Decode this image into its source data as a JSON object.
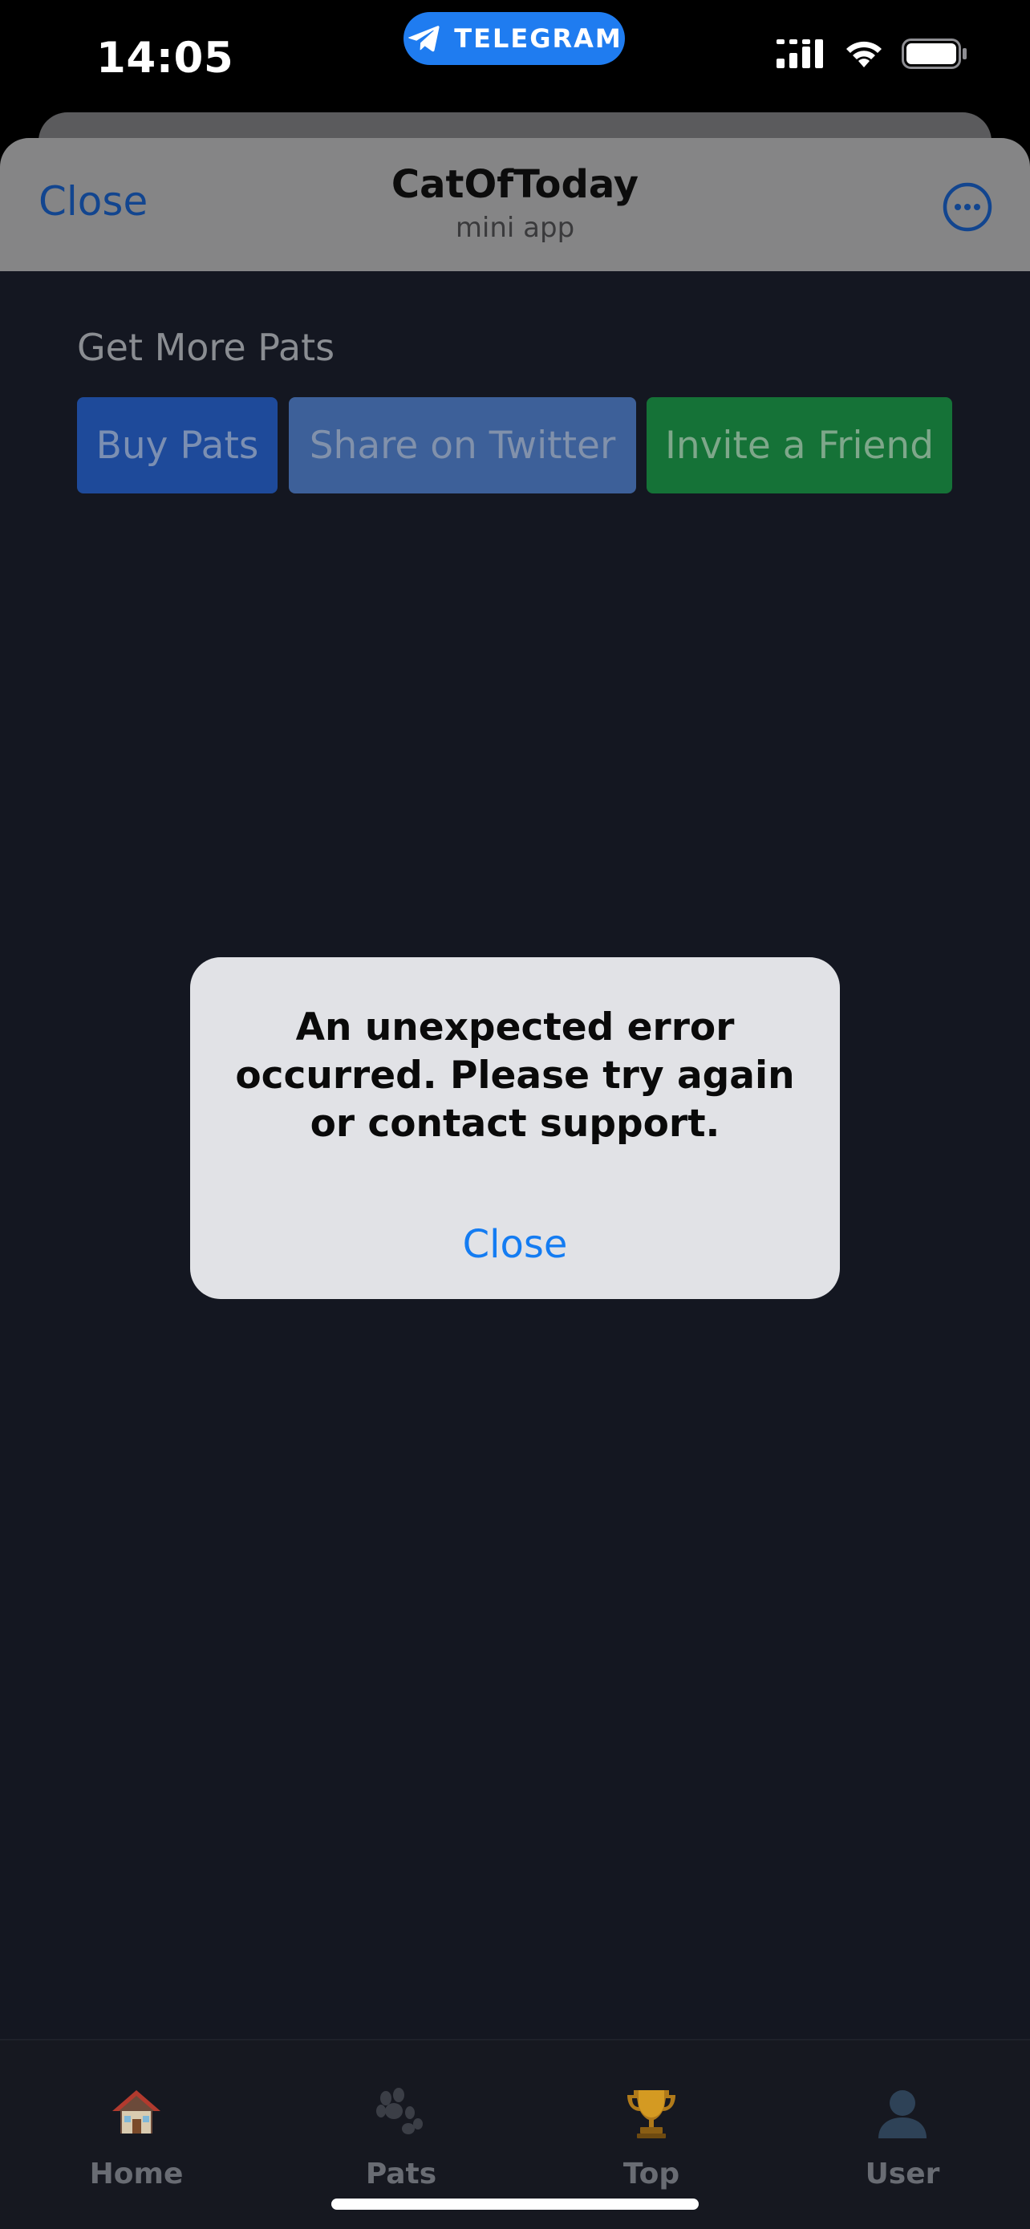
{
  "status_bar": {
    "time": "14:05",
    "telegram_label": "TELEGRAM"
  },
  "header": {
    "close_label": "Close",
    "title": "CatOfToday",
    "subtitle": "mini app"
  },
  "content": {
    "section_title": "Get More Pats",
    "buttons": {
      "buy": "Buy Pats",
      "share": "Share on Twitter",
      "invite": "Invite a Friend"
    }
  },
  "alert": {
    "message": "An unexpected error occurred. Please try again or contact support.",
    "close_label": "Close"
  },
  "bottom_nav": {
    "items": [
      {
        "label": "Home",
        "icon": "house-icon"
      },
      {
        "label": "Pats",
        "icon": "paw-icon"
      },
      {
        "label": "Top",
        "icon": "trophy-icon"
      },
      {
        "label": "User",
        "icon": "user-silhouette-icon"
      }
    ]
  },
  "colors": {
    "app_background": "#141721",
    "header_background": "#858586",
    "alert_background": "#e1e2e6",
    "link_blue": "#147cf2",
    "telegram_blue": "#1f7cf0",
    "buy_button": "#1e4a9a",
    "share_button": "#3d6099",
    "invite_button": "#157237"
  }
}
